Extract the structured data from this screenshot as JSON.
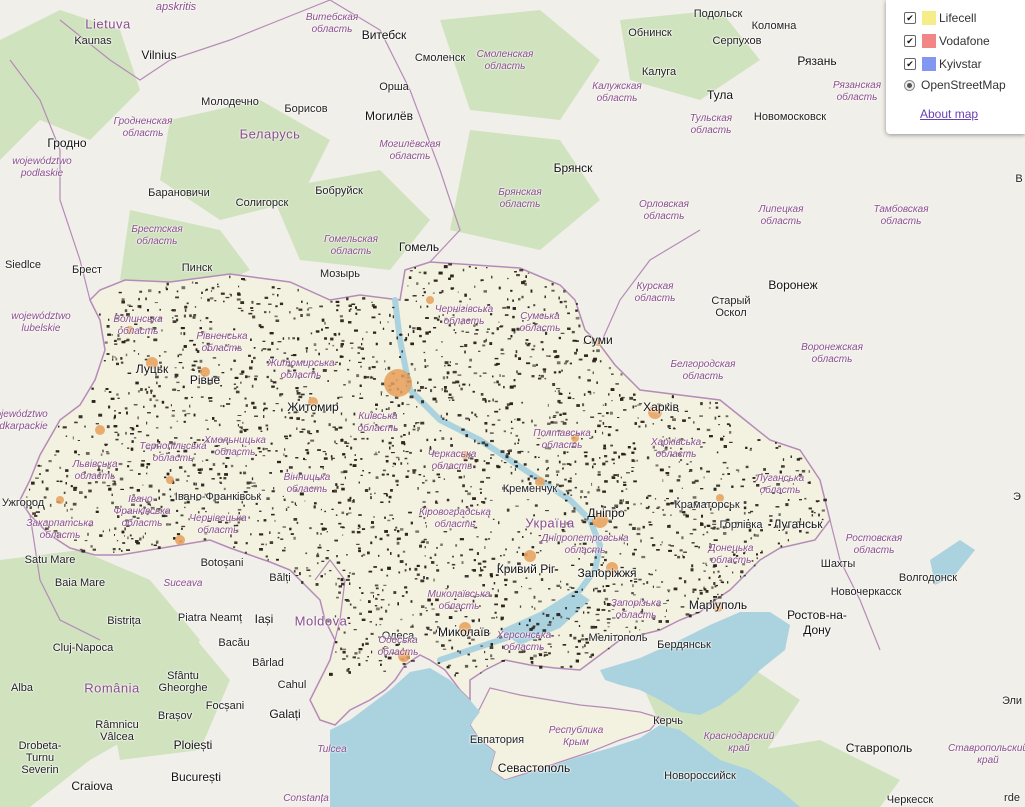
{
  "layers": {
    "items": [
      {
        "label": "Lifecell",
        "checked": true,
        "color": "#f6ed8a"
      },
      {
        "label": "Vodafone",
        "checked": true,
        "color": "#f28585"
      },
      {
        "label": "Kyivstar",
        "checked": true,
        "color": "#8297f2"
      }
    ],
    "base_label": "OpenStreetMap",
    "about_label": "About map"
  },
  "map": {
    "colors": {
      "land": "#f1efe9",
      "ukraine": "#f3f1df",
      "water": "#aad3df",
      "forest": "#c8e0b4",
      "border": "#b58bb8",
      "coverage": "#2a231c",
      "city_coverage": "#e8a05a"
    },
    "countries": {
      "belarus": "Беларусь",
      "ukraine": "Україна",
      "moldova": "Moldova",
      "romania": "România",
      "lithuania": "Lietuva"
    },
    "cities": {
      "apskritis": "apskritis",
      "vilnius": "Vilnius",
      "kaunas": "Kaunas",
      "vitebsk": "Витебск",
      "smolensk": "Смоленск",
      "obninsk": "Обнинск",
      "serpukhov": "Серпухов",
      "podolsk": "Подольск",
      "kolomna": "Коломна",
      "kaluga": "Калуга",
      "ryazan": "Рязань",
      "tula": "Тула",
      "novomoskovsk": "Новомосковск",
      "orsha": "Орша",
      "molodechno": "Молодечно",
      "borisov": "Борисов",
      "mogilev": "Могилёв",
      "grodno": "Гродно",
      "baranovichi": "Барановичи",
      "soligorsk": "Солигорск",
      "bobruisk": "Бобруйск",
      "bryansk": "Брянск",
      "gomel": "Гомель",
      "siedlce": "Siedlce",
      "brest": "Брест",
      "pinsk": "Пинск",
      "mozyr": "Мозырь",
      "voronezh": "Воронеж",
      "stary_oskol": "Старый\nОскол",
      "sumy": "Суми",
      "lutsk": "Луцьк",
      "rivne": "Рівне",
      "zhytomyr": "Житомир",
      "kharkiv": "Харків",
      "kremenchuk": "Кременчук",
      "kramatorsk": "Краматорськ",
      "dnipro": "Дніпро",
      "horlivka": "Горлівка",
      "luhansk": "Луганськ",
      "shakhty": "Шахты",
      "volgodonsk": "Волгодонск",
      "novocherkassk": "Новочеркасск",
      "uzhhorod": "Ужгород",
      "ivano_frankivsk": "Івано-Франківськ",
      "satu_mare": "Satu Mare",
      "baia_mare": "Baia Mare",
      "botosani": "Botoșani",
      "balti": "Bălți",
      "kryvyi_rih": "Кривий Ріг",
      "zaporizhzhia": "Запоріжжя",
      "mariupol": "Маріуполь",
      "rostov": "Ростов-на-\nДону",
      "cluj": "Cluj-Napoca",
      "bistrita": "Bistrița",
      "piatra_neamt": "Piatra Neamț",
      "iasi": "Iași",
      "bacau": "Bacău",
      "mykolaiv": "Миколаїв",
      "odesa": "Одеса",
      "melitopol": "Мелітополь",
      "berdiansk": "Бердянськ",
      "barlad": "Bârlad",
      "sfantu": "Sfântu\nGheorghe",
      "cahul": "Cahul",
      "alba": "Alba",
      "ramnicu": "Râmnicu\nVâlcea",
      "brasov": "Brașov",
      "focsani": "Focșani",
      "galati": "Galați",
      "drobeta": "Drobeta-\nTurnu\nSeverin",
      "ploiesti": "Ploiești",
      "craiova": "Craiova",
      "bucuresti": "București",
      "kerch": "Керчь",
      "yevpatoria": "Евпатория",
      "sevastopol": "Севастополь",
      "novorossiysk": "Новороссийск",
      "stavropol": "Ставрополь",
      "elista": "Эли",
      "cherkessk": "Черкесск",
      "orde": "rde",
      "v_edge": "В",
      "e_edge": "Э"
    },
    "regions": {
      "vitebsk_obl": "Витебская\nобласть",
      "smolensk_obl": "Смоленская\nобласть",
      "kaluga_obl": "Калужская\nобласть",
      "ryazan_obl": "Рязанская\nобласть",
      "tula_obl": "Тульская\nобласть",
      "grodno_obl": "Гродненская\nобласть",
      "mogilev_obl": "Могилёвская\nобласть",
      "bryansk_obl": "Брянская\nобласть",
      "orel_obl": "Орловская\nобласть",
      "lipetsk_obl": "Липецкая\nобласть",
      "tambov_obl": "Тамбовская\nобласть",
      "podlaskie": "województwo\npodlaskie",
      "brest_obl": "Брестская\nобласть",
      "gomel_obl": "Гомельская\nобласть",
      "kursk_obl": "Курская\nобласть",
      "lubelskie": "województwo\nlubelskie",
      "volyn": "Волинська\nобласть",
      "rivne_obl": "Рівненська\nобласть",
      "zhytomyr_obl": "Житомирська\nобласть",
      "sumy_obl": "Сумська\nобласть",
      "belgorod_obl": "Белгородская\nобласть",
      "voronezh_obl": "Воронежская\nобласть",
      "kharkiv_obl": "Харківська\nобласть",
      "podkarpackie": "województwo\npodkarpackie",
      "khmelnytskyi": "Хмельницька\nобласть",
      "vinnytsia": "Вінницька\nобласть",
      "poltava": "Полтавська\nобласть",
      "kirovohrad": "Кіровоградська\nобласть",
      "zakarpattia": "Закарпатська\nобласть",
      "ivano_obl": "Івано-\nФранківська\nобласть",
      "chernivtsi": "Чернівецька\nобласть",
      "dnipro_obl": "Дніпропетровська\nобласть",
      "donetsk": "Донецька\nобласть",
      "luhansk_obl": "Луганська\nобласть",
      "rostov_obl": "Ростовская\nобласть",
      "suceava": "Suceava",
      "mykolaiv_obl": "Миколаївська\nобласть",
      "odesa_obl": "Одеська\nобласть",
      "kherson": "Херсонська\nобласть",
      "zaporizhzhia_obl": "Запорізька\nобласть",
      "tulcea": "Tulcea",
      "constanta": "Constanța",
      "crimea": "Республика\nКрым",
      "krasnodar": "Краснодарский\nкрай",
      "stavropol_kr": "Ставропольский\nкрай",
      "kyiv_obl": "Київська\nобласть",
      "cherkasy": "Черкаська\nобласть",
      "chernihiv": "Чернігівська\nобласть",
      "ternopil": "Тернопільська\nобласть",
      "lviv": "Львівська\nобласть"
    }
  }
}
